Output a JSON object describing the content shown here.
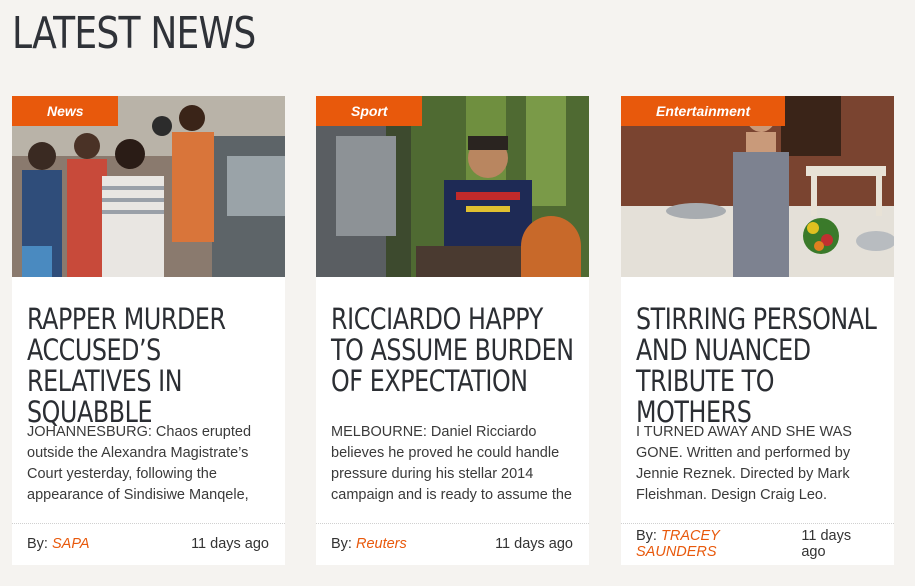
{
  "section": {
    "title": "LATEST NEWS"
  },
  "byline_prefix": "By:",
  "accent_color": "#e8590c",
  "cards": [
    {
      "category": "News",
      "headline": "RAPPER MURDER ACCUSED’S RELATIVES IN SQUABBLE",
      "excerpt": "JOHANNESBURG: Chaos erupted outside the Alexandra Magistrate’s Court yesterday, following the appearance of Sindisiwe Manqele,",
      "author": "SAPA",
      "date": "11 days ago"
    },
    {
      "category": "Sport",
      "headline": "RICCIARDO HAPPY TO ASSUME BURDEN OF EXPECTATION",
      "excerpt": "MELBOURNE: Daniel Ricciardo believes he proved he could handle pressure during his stellar 2014 campaign and is ready to assume the",
      "author": "Reuters",
      "date": "11 days ago"
    },
    {
      "category": "Entertainment",
      "headline": "STIRRING PERSONAL AND NUANCED TRIBUTE TO MOTHERS",
      "excerpt": "I TURNED AWAY AND SHE WAS GONE. Written and performed by Jennie Reznek. Directed by Mark Fleishman. Design Craig Leo.",
      "author": "TRACEY SAUNDERS",
      "date": "11 days ago"
    }
  ]
}
